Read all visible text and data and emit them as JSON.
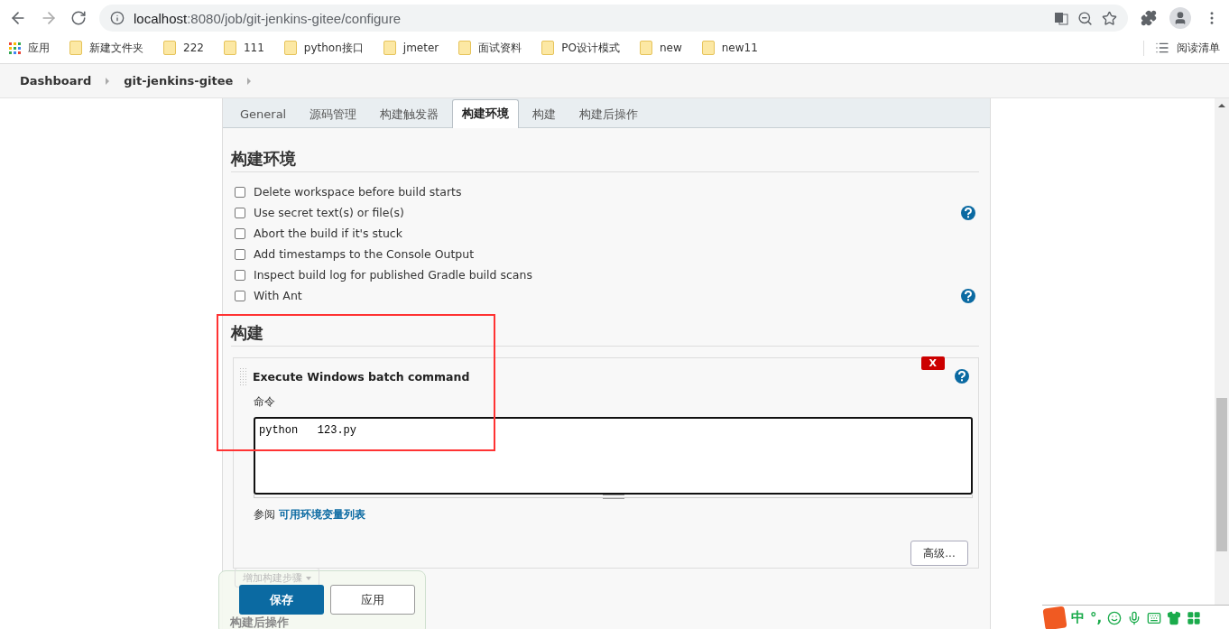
{
  "browser": {
    "url_host": "localhost",
    "url_rest": ":8080/job/git-jenkins-gitee/configure",
    "reading_list": "阅读清单",
    "bookmarks": [
      {
        "label": "应用",
        "kind": "apps"
      },
      {
        "label": "新建文件夹",
        "kind": "folder"
      },
      {
        "label": "222",
        "kind": "folder"
      },
      {
        "label": "111",
        "kind": "folder"
      },
      {
        "label": "python接口",
        "kind": "folder"
      },
      {
        "label": "jmeter",
        "kind": "folder"
      },
      {
        "label": "面试资料",
        "kind": "folder"
      },
      {
        "label": "PO设计模式",
        "kind": "folder"
      },
      {
        "label": "new",
        "kind": "folder"
      },
      {
        "label": "new11",
        "kind": "folder"
      }
    ]
  },
  "breadcrumbs": [
    "Dashboard",
    "git-jenkins-gitee"
  ],
  "tabs": [
    {
      "label": "General",
      "selected": false
    },
    {
      "label": "源码管理",
      "selected": false
    },
    {
      "label": "构建触发器",
      "selected": false
    },
    {
      "label": "构建环境",
      "selected": true
    },
    {
      "label": "构建",
      "selected": false
    },
    {
      "label": "构建后操作",
      "selected": false
    }
  ],
  "env_section": {
    "title": "构建环境",
    "options": [
      {
        "label": "Delete workspace before build starts",
        "checked": false,
        "help": false
      },
      {
        "label": "Use secret text(s) or file(s)",
        "checked": false,
        "help": true
      },
      {
        "label": "Abort the build if it's stuck",
        "checked": false,
        "help": false
      },
      {
        "label": "Add timestamps to the Console Output",
        "checked": false,
        "help": false
      },
      {
        "label": "Inspect build log for published Gradle build scans",
        "checked": false,
        "help": false
      },
      {
        "label": "With Ant",
        "checked": false,
        "help": true
      }
    ]
  },
  "build_section": {
    "title": "构建",
    "step": {
      "title": "Execute Windows batch command",
      "delete": "X",
      "field_label": "命令",
      "command": "python   123.py",
      "see_prefix": "参阅",
      "see_link": "可用环境变量列表",
      "advanced": "高级..."
    }
  },
  "bottom_bar": {
    "add_step": "增加构建步骤",
    "save": "保存",
    "apply": "应用",
    "next_section": "构建后操作"
  },
  "ime": {
    "mode": "中",
    "punct": "°,"
  }
}
